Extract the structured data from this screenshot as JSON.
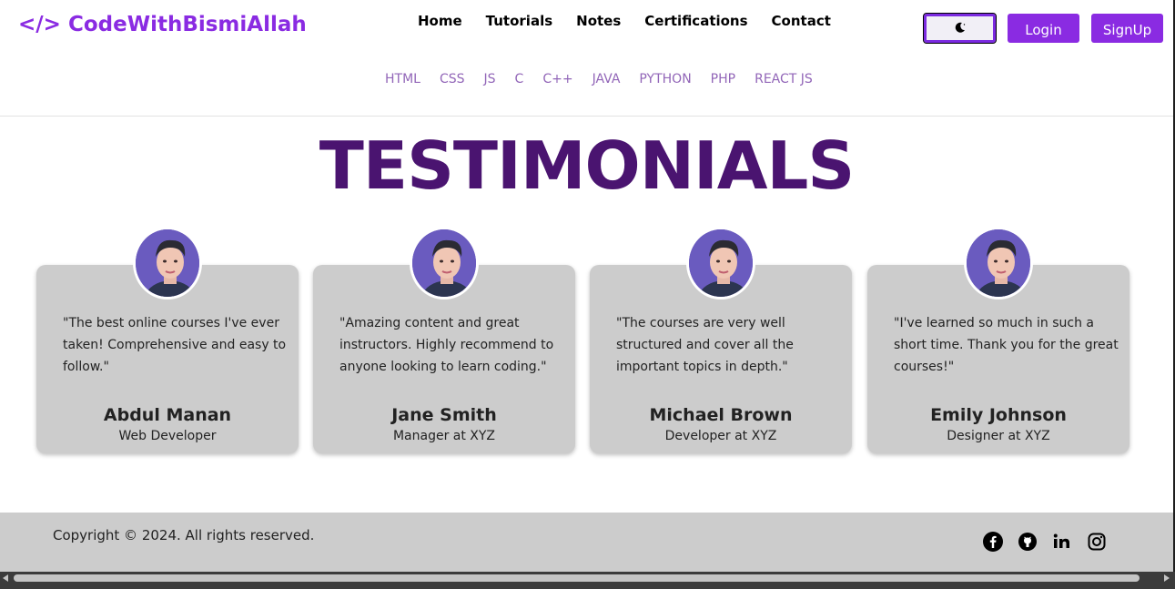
{
  "header": {
    "logo_icon": "</>",
    "logo_text": "CodeWithBismiAllah",
    "nav": [
      "Home",
      "Tutorials",
      "Notes",
      "Certifications",
      "Contact"
    ],
    "theme_toggle_icon": "moon-icon",
    "login_label": "Login",
    "signup_label": "SignUp"
  },
  "languages": [
    "HTML",
    "CSS",
    "JS",
    "C",
    "C++",
    "JAVA",
    "PYTHON",
    "PHP",
    "REACT JS"
  ],
  "page_title": "TESTIMONIALS",
  "testimonials": [
    {
      "quote": "\"The best online courses I've ever taken! Comprehensive and easy to follow.\"",
      "name": "Abdul Manan",
      "role": "Web Developer"
    },
    {
      "quote": "\"Amazing content and great instructors. Highly recommend to anyone looking to learn coding.\"",
      "name": "Jane Smith",
      "role": "Manager at XYZ"
    },
    {
      "quote": "\"The courses are very well structured and cover all the important topics in depth.\"",
      "name": "Michael Brown",
      "role": "Developer at XYZ"
    },
    {
      "quote": "\"I've learned so much in such a short time. Thank you for the great courses!\"",
      "name": "Emily Johnson",
      "role": "Designer at XYZ"
    }
  ],
  "footer": {
    "copyright": "Copyright © 2024. All rights reserved.",
    "social_icons": [
      "facebook-icon",
      "github-icon",
      "linkedin-icon",
      "instagram-icon"
    ]
  },
  "colors": {
    "brand": "#8a2be2",
    "title": "#4a1470",
    "lang_link": "#9266b8",
    "card_bg": "#cccccc",
    "footer_bg": "#cccccc"
  }
}
